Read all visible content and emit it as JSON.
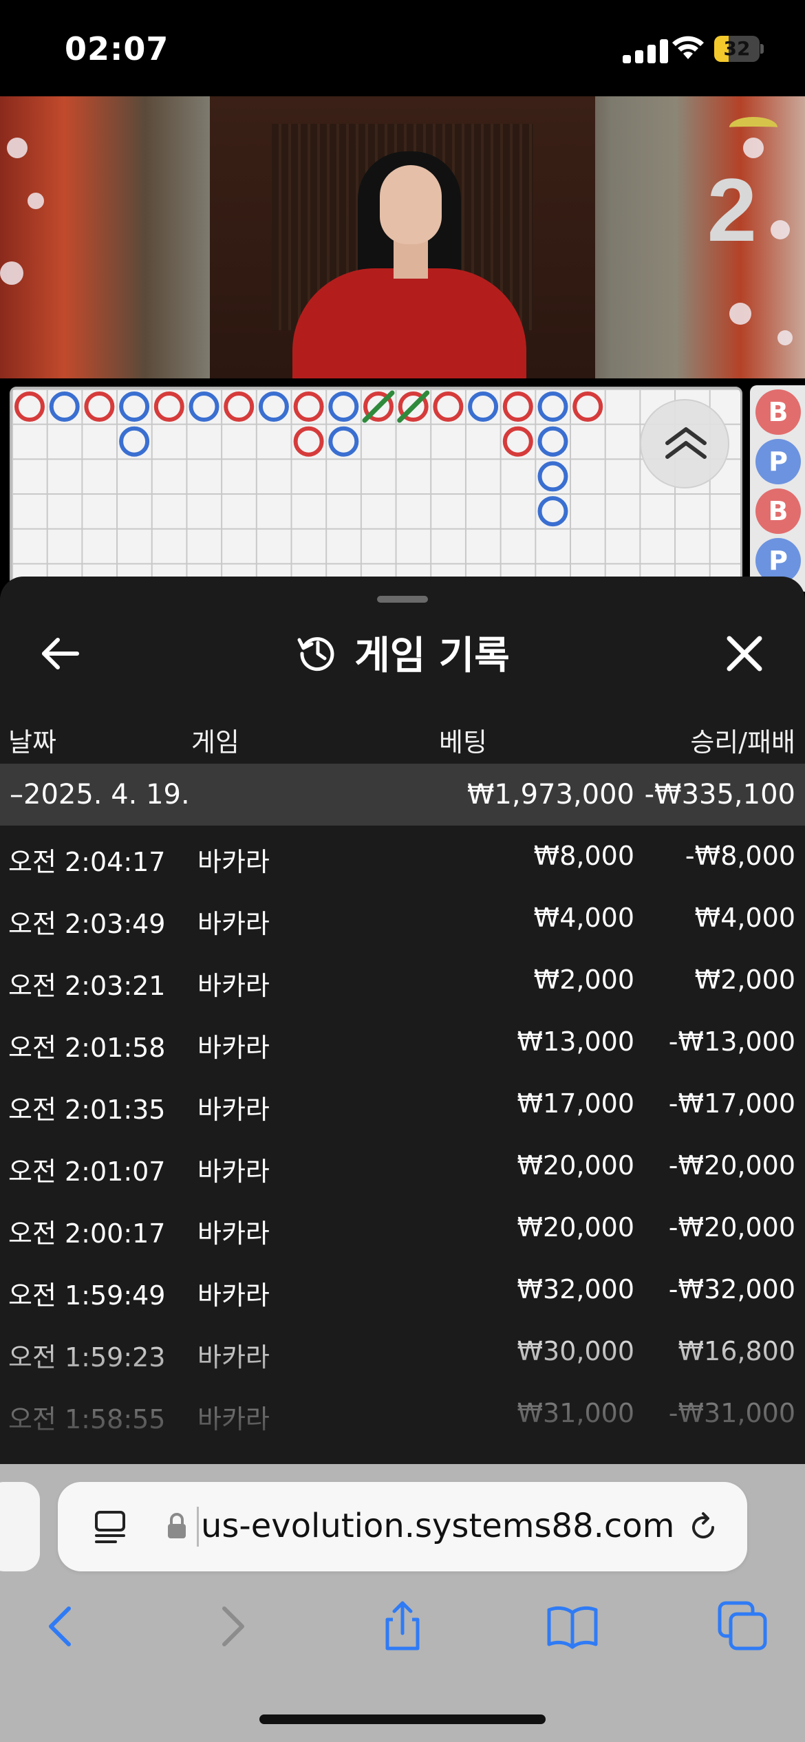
{
  "status_bar": {
    "time": "02:07",
    "battery": "32",
    "battery_level": 0.32
  },
  "video": {
    "shoe_count": "2"
  },
  "side_beads": [
    "B",
    "P",
    "B",
    "P"
  ],
  "sheet": {
    "title": "게임 기록",
    "columns": {
      "date": "날짜",
      "game": "게임",
      "bet": "베팅",
      "result": "승리/패배"
    },
    "day_row": {
      "date": "–2025. 4. 19.",
      "bet": "₩1,973,000",
      "result": "-₩335,100"
    },
    "rows": [
      {
        "time": "오전 2:04:17",
        "game": "바카라",
        "bet": "₩8,000",
        "result": "-₩8,000"
      },
      {
        "time": "오전 2:03:49",
        "game": "바카라",
        "bet": "₩4,000",
        "result": "₩4,000"
      },
      {
        "time": "오전 2:03:21",
        "game": "바카라",
        "bet": "₩2,000",
        "result": "₩2,000"
      },
      {
        "time": "오전 2:01:58",
        "game": "바카라",
        "bet": "₩13,000",
        "result": "-₩13,000"
      },
      {
        "time": "오전 2:01:35",
        "game": "바카라",
        "bet": "₩17,000",
        "result": "-₩17,000"
      },
      {
        "time": "오전 2:01:07",
        "game": "바카라",
        "bet": "₩20,000",
        "result": "-₩20,000"
      },
      {
        "time": "오전 2:00:17",
        "game": "바카라",
        "bet": "₩20,000",
        "result": "-₩20,000"
      },
      {
        "time": "오전 1:59:49",
        "game": "바카라",
        "bet": "₩32,000",
        "result": "-₩32,000"
      },
      {
        "time": "오전 1:59:23",
        "game": "바카라",
        "bet": "₩30,000",
        "result": "₩16,800"
      },
      {
        "time": "오전 1:58:55",
        "game": "바카라",
        "bet": "₩31,000",
        "result": "-₩31,000"
      }
    ]
  },
  "browser": {
    "url": "us-evolution.systems88.com"
  },
  "colors": {
    "banker": "#d63b3b",
    "player": "#3a6fd1",
    "tie": "#2f8a3c",
    "sheet_bg": "#1b1b1b",
    "day_row_bg": "#3a3a3a",
    "browser_accent": "#2f7bf5"
  },
  "roadmap": {
    "columns": [
      [
        "B"
      ],
      [
        "P"
      ],
      [
        "B"
      ],
      [
        "P",
        "P"
      ],
      [
        "B"
      ],
      [
        "P"
      ],
      [
        "B"
      ],
      [
        "P"
      ],
      [
        "B",
        "B"
      ],
      [
        "P",
        "P"
      ],
      [
        "B-tie"
      ],
      [
        "B-tie"
      ],
      [
        "B"
      ],
      [
        "P"
      ],
      [
        "B",
        "B"
      ],
      [
        "P",
        "P",
        "P",
        "P"
      ],
      [
        "B"
      ]
    ]
  }
}
